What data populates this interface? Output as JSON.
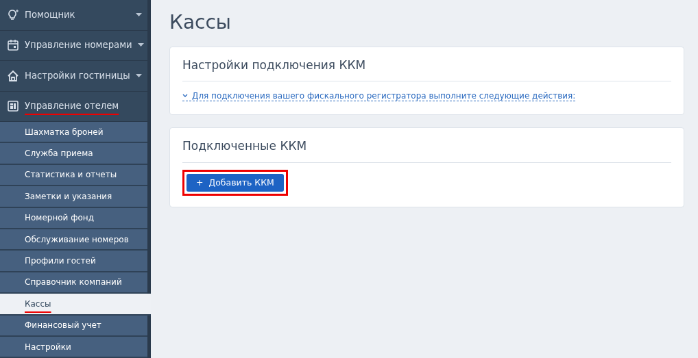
{
  "sidebar": {
    "items": [
      {
        "label": "Помощник",
        "expanded": false,
        "highlighted": false
      },
      {
        "label": "Управление номерами",
        "expanded": false,
        "highlighted": false
      },
      {
        "label": "Настройки гостиницы",
        "expanded": false,
        "highlighted": false
      },
      {
        "label": "Управление отелем",
        "expanded": true,
        "highlighted": true,
        "children": [
          {
            "label": "Шахматка броней",
            "selected": false,
            "highlighted": false
          },
          {
            "label": "Служба приема",
            "selected": false,
            "highlighted": false
          },
          {
            "label": "Статистика и отчеты",
            "selected": false,
            "highlighted": false
          },
          {
            "label": "Заметки и указания",
            "selected": false,
            "highlighted": false
          },
          {
            "label": "Номерной фонд",
            "selected": false,
            "highlighted": false
          },
          {
            "label": "Обслуживание номеров",
            "selected": false,
            "highlighted": false
          },
          {
            "label": "Профили гостей",
            "selected": false,
            "highlighted": false
          },
          {
            "label": "Справочник компаний",
            "selected": false,
            "highlighted": false
          },
          {
            "label": "Кассы",
            "selected": true,
            "highlighted": true
          },
          {
            "label": "Финансовый учет",
            "selected": false,
            "highlighted": false
          },
          {
            "label": "Настройки",
            "selected": false,
            "highlighted": false
          }
        ]
      }
    ]
  },
  "page": {
    "title": "Кассы"
  },
  "cards": [
    {
      "title": "Настройки подключения ККМ",
      "kind": "link",
      "link": {
        "text": "Для подключения вашего фискального регистратора выполните следующие действия:",
        "expanded": false
      }
    },
    {
      "title": "Подключенные ККМ",
      "kind": "button",
      "button": {
        "label": "Добавить ККМ",
        "icon": "+",
        "highlighted": true
      }
    }
  ]
}
